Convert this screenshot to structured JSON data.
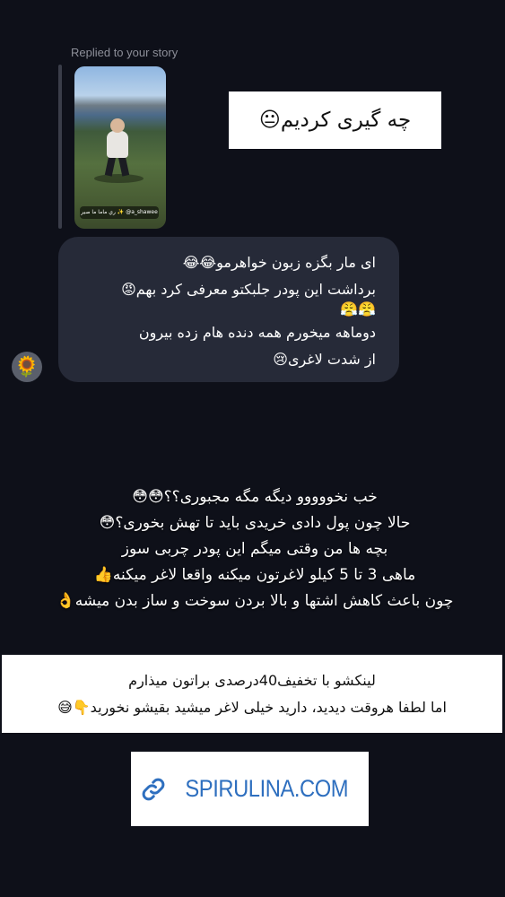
{
  "reply": {
    "label": "Replied to your story",
    "story_caption": "ري ماما ما صير ✨ @a_shawee"
  },
  "header_box": {
    "text": "چه گیری کردیم😐"
  },
  "incoming_message": {
    "lines": [
      "ای مار بگزه زبون خواهرمو😂😂",
      "برداشت این پودر جلبکتو معرفی کرد بهم😡",
      "😤😤",
      "دوماهه میخورم همه دنده هام زده بیرون",
      "از شدت لاغری😢"
    ]
  },
  "sender": {
    "avatar_icon": "sunflower-icon",
    "avatar_glyph": "🌻"
  },
  "story_text": {
    "lines": [
      "خب نخووووو دیگه مگه مجبوری؟؟😳😳",
      "حالا چون پول دادی خریدی باید تا تهش بخوری؟😳",
      "بچه ها من وقتی میگم این پودر چربی سوز",
      "ماهی 3 تا 5 کیلو لاغرتون میکنه واقعا لاغر میکنه👍",
      "چون باعث کاهش اشتها و بالا بردن سوخت و ساز بدن میشه👌"
    ]
  },
  "info_box": {
    "lines": [
      "لینکشو با تخفیف40درصدی براتون میذارم",
      "اما لطفا هروقت دیدید، دارید خیلی لاغر میشید بقیشو نخورید👇😅"
    ]
  },
  "link_sticker": {
    "icon": "link-icon",
    "text": "SPIRULINA.COM",
    "color": "#2e6fbf"
  }
}
